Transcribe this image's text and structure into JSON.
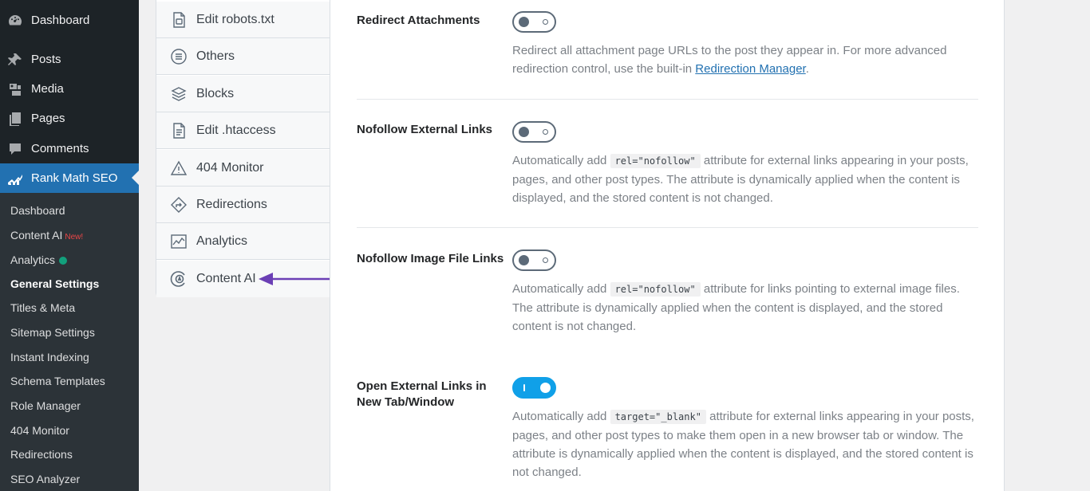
{
  "wp_menu": [
    {
      "label": "Dashboard",
      "icon": "dashboard-icon"
    },
    {
      "label": "Posts",
      "icon": "pin-icon"
    },
    {
      "label": "Media",
      "icon": "media-icon"
    },
    {
      "label": "Pages",
      "icon": "pages-icon"
    },
    {
      "label": "Comments",
      "icon": "comments-icon"
    },
    {
      "label": "Rank Math SEO",
      "icon": "rank-math-icon",
      "active": true
    }
  ],
  "rm_submenu": [
    {
      "label": "Dashboard"
    },
    {
      "label": "Content AI",
      "badge": "New!"
    },
    {
      "label": "Analytics",
      "dot": true
    },
    {
      "label": "General Settings",
      "current": true
    },
    {
      "label": "Titles & Meta"
    },
    {
      "label": "Sitemap Settings"
    },
    {
      "label": "Instant Indexing"
    },
    {
      "label": "Schema Templates"
    },
    {
      "label": "Role Manager"
    },
    {
      "label": "404 Monitor"
    },
    {
      "label": "Redirections"
    },
    {
      "label": "SEO Analyzer"
    }
  ],
  "settings_nav": [
    {
      "label": "Edit robots.txt",
      "icon": "robots-file-icon"
    },
    {
      "label": "Others",
      "icon": "list-circle-icon"
    },
    {
      "label": "Blocks",
      "icon": "blocks-icon"
    },
    {
      "label": "Edit .htaccess",
      "icon": "htaccess-file-icon"
    },
    {
      "label": "404 Monitor",
      "icon": "warning-triangle-icon"
    },
    {
      "label": "Redirections",
      "icon": "redirect-diamond-icon"
    },
    {
      "label": "Analytics",
      "icon": "analytics-chart-icon"
    },
    {
      "label": "Content AI",
      "icon": "content-ai-icon"
    }
  ],
  "fields": [
    {
      "label": "Redirect Attachments",
      "enabled": false,
      "desc_before": "Redirect all attachment page URLs to the post they appear in. For more advanced redirection control, use the built-in ",
      "link": "Redirection Manager",
      "desc_after": "."
    },
    {
      "label": "Nofollow External Links",
      "enabled": false,
      "desc_before": "Automatically add ",
      "code": "rel=\"nofollow\"",
      "desc_after": " attribute for external links appearing in your posts, pages, and other post types. The attribute is dynamically applied when the content is displayed, and the stored content is not changed."
    },
    {
      "label": "Nofollow Image File Links",
      "enabled": false,
      "desc_before": "Automatically add ",
      "code": "rel=\"nofollow\"",
      "desc_after": " attribute for links pointing to external image files. The attribute is dynamically applied when the content is displayed, and the stored content is not changed."
    },
    {
      "label": "Open External Links in New Tab/Window",
      "enabled": true,
      "desc_before": "Automatically add ",
      "code": "target=\"_blank\"",
      "desc_after": " attribute for external links appearing in your posts, pages, and other post types to make them open in a new browser tab or window. The attribute is dynamically applied when the content is displayed, and the stored content is not changed."
    }
  ],
  "colors": {
    "sidebar_bg": "#1d2327",
    "active_menu": "#2271b1",
    "toggle_on": "#10a0e8",
    "annotation_arrow": "#6b3fb5"
  }
}
